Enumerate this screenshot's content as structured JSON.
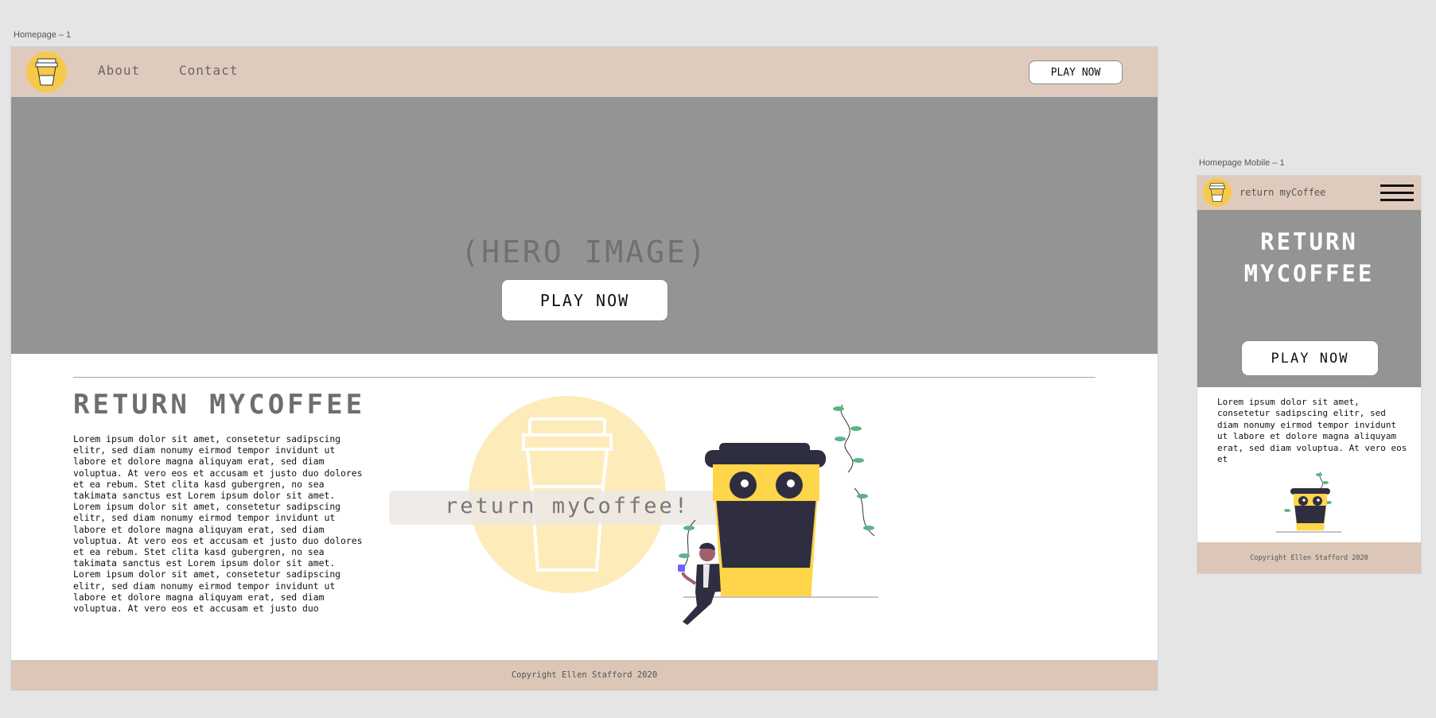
{
  "desktop": {
    "frame_label": "Homepage – 1",
    "nav": {
      "links": [
        "About",
        "Contact"
      ],
      "cta_label": "PLAY NOW"
    },
    "hero": {
      "placeholder": "(HERO IMAGE)",
      "cta_label": "PLAY NOW"
    },
    "section": {
      "title": "RETURN MYCOFFEE",
      "body": "Lorem ipsum dolor sit amet, consetetur sadipscing elitr, sed diam nonumy eirmod tempor invidunt ut labore et dolore magna aliquyam erat, sed diam voluptua. At vero eos et accusam et justo duo dolores et ea rebum. Stet clita kasd gubergren, no sea takimata sanctus est Lorem ipsum dolor sit amet. Lorem ipsum dolor sit amet, consetetur sadipscing elitr, sed diam nonumy eirmod tempor invidunt ut labore et dolore magna aliquyam erat, sed diam voluptua. At vero eos et accusam et justo duo dolores et ea rebum. Stet clita kasd gubergren, no sea takimata sanctus est Lorem ipsum dolor sit amet.",
      "body2": "Lorem ipsum dolor sit amet, consetetur sadipscing elitr, sed diam nonumy eirmod tempor invidunt ut labore et dolore magna aliquyam erat, sed diam voluptua. At vero eos et accusam et justo duo",
      "logo_banner": "return myCoffee!"
    },
    "footer": "Copyright Ellen Stafford 2020"
  },
  "mobile": {
    "frame_label": "Homepage Mobile – 1",
    "nav": {
      "brand": "return myCoffee"
    },
    "hero": {
      "title_line1": "RETURN",
      "title_line2": "MYCOFFEE",
      "cta_label": "PLAY NOW"
    },
    "body": "Lorem ipsum dolor sit amet, consetetur sadipscing elitr, sed diam nonumy eirmod tempor invidunt ut labore et dolore magna aliquyam erat, sed diam voluptua. At vero eos et",
    "footer": "Copyright Ellen Stafford 2020"
  },
  "colors": {
    "nav_bg": "#dfcbbd",
    "hero_bg": "#949494",
    "accent_yellow": "#f7c94a",
    "cup_dark": "#2f2e41",
    "leaf_green": "#5bb486"
  },
  "icons": [
    "coffee-cup-logo-icon",
    "hamburger-menu-icon"
  ]
}
